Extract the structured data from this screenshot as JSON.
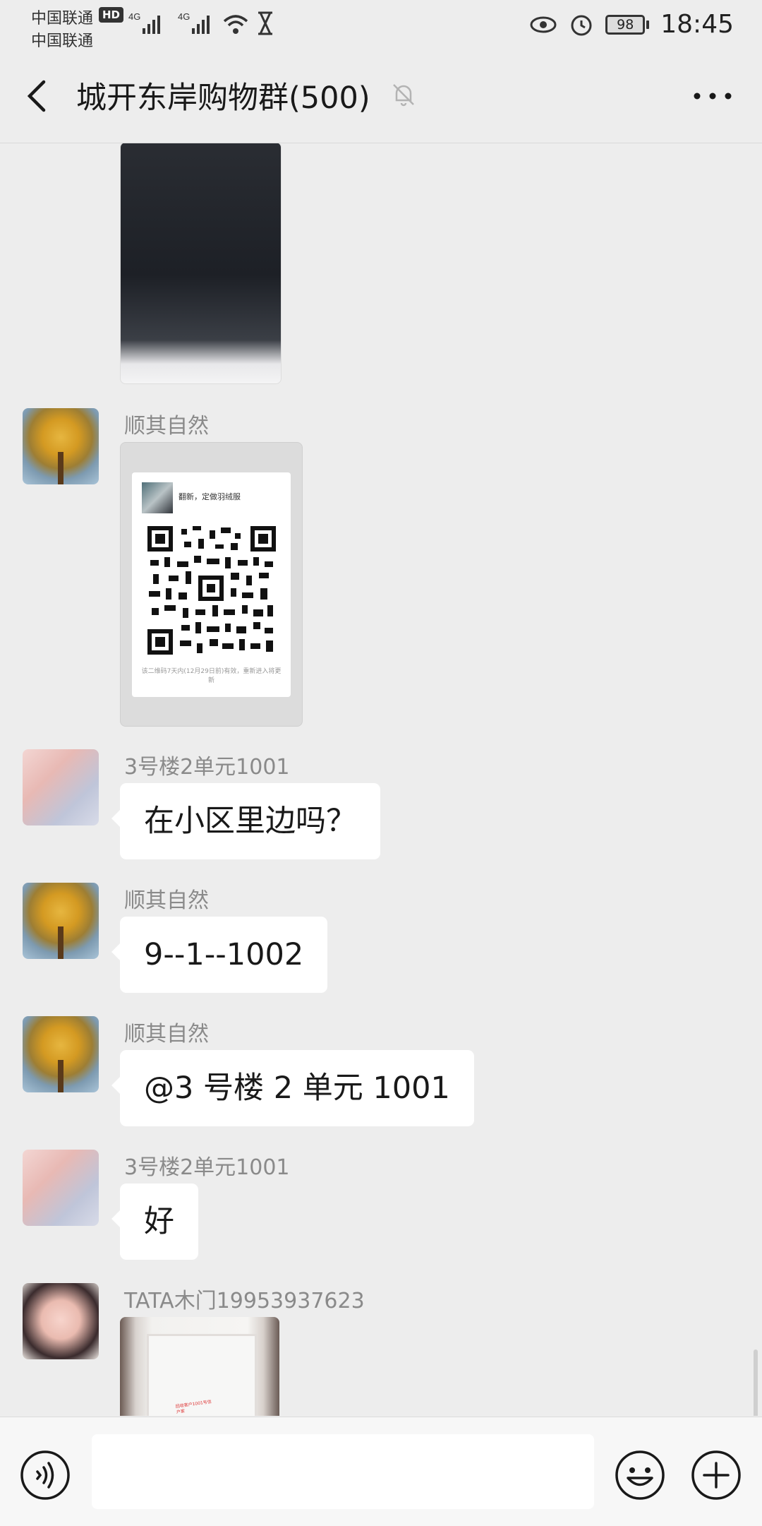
{
  "status_bar": {
    "carrier_1": "中国联通",
    "carrier_2": "中国联通",
    "hd_badge": "HD",
    "network_1": "4G",
    "network_2": "4G",
    "battery_level": "98",
    "time": "18:45"
  },
  "header": {
    "title": "城开东岸购物群(500)"
  },
  "messages": [
    {
      "sender": "顺其自然",
      "qr_card": {
        "title": "翻新，定做羽绒服",
        "footer": "该二维码7天内(12月29日前)有效，重新进入将更新"
      }
    },
    {
      "sender": "3号楼2单元1001",
      "text": "在小区里边吗？"
    },
    {
      "sender": "顺其自然",
      "text": "9--1--1002"
    },
    {
      "sender": "顺其自然",
      "text": "@3 号楼 2 单元 1001"
    },
    {
      "sender": "3号楼2单元1001",
      "text": "好"
    },
    {
      "sender": "TATA木门19953937623",
      "image_stamp": "回收客户1001号住户家"
    }
  ],
  "input": {
    "value": "",
    "placeholder": ""
  },
  "icons": {
    "back": "chevron-left-icon",
    "mute": "bell-off-icon",
    "more": "more-horizontal-icon",
    "voice": "voice-icon",
    "emoji": "emoji-icon",
    "plus": "plus-icon"
  }
}
